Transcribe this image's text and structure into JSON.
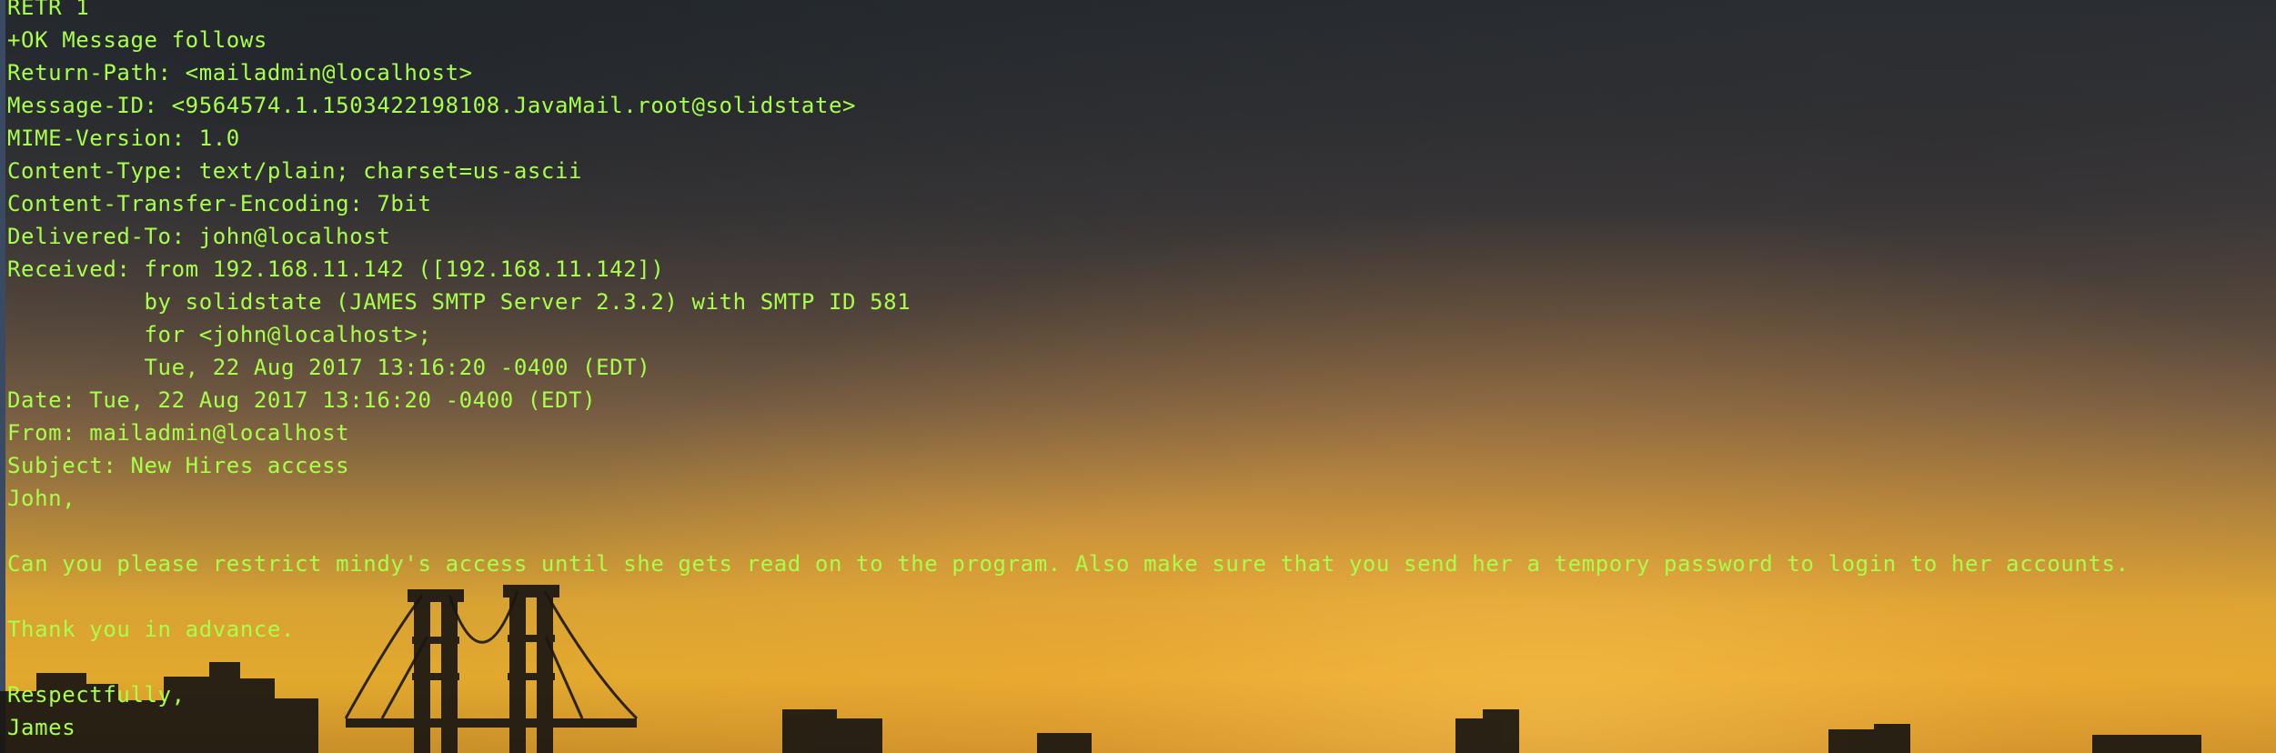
{
  "terminal": {
    "lines": [
      "RETR 1",
      "+OK Message follows",
      "Return-Path: <mailadmin@localhost>",
      "Message-ID: <9564574.1.1503422198108.JavaMail.root@solidstate>",
      "MIME-Version: 1.0",
      "Content-Type: text/plain; charset=us-ascii",
      "Content-Transfer-Encoding: 7bit",
      "Delivered-To: john@localhost",
      "Received: from 192.168.11.142 ([192.168.11.142])",
      "          by solidstate (JAMES SMTP Server 2.3.2) with SMTP ID 581",
      "          for <john@localhost>;",
      "          Tue, 22 Aug 2017 13:16:20 -0400 (EDT)",
      "Date: Tue, 22 Aug 2017 13:16:20 -0400 (EDT)",
      "From: mailadmin@localhost",
      "Subject: New Hires access",
      "John,",
      "",
      "Can you please restrict mindy's access until she gets read on to the program. Also make sure that you send her a tempory password to login to her accounts.",
      "",
      "Thank you in advance.",
      "",
      "Respectfully,",
      "James"
    ]
  },
  "colors": {
    "text": "#a8ff4a",
    "sky_top": "#2f3439",
    "horizon": "#e2a92e"
  }
}
